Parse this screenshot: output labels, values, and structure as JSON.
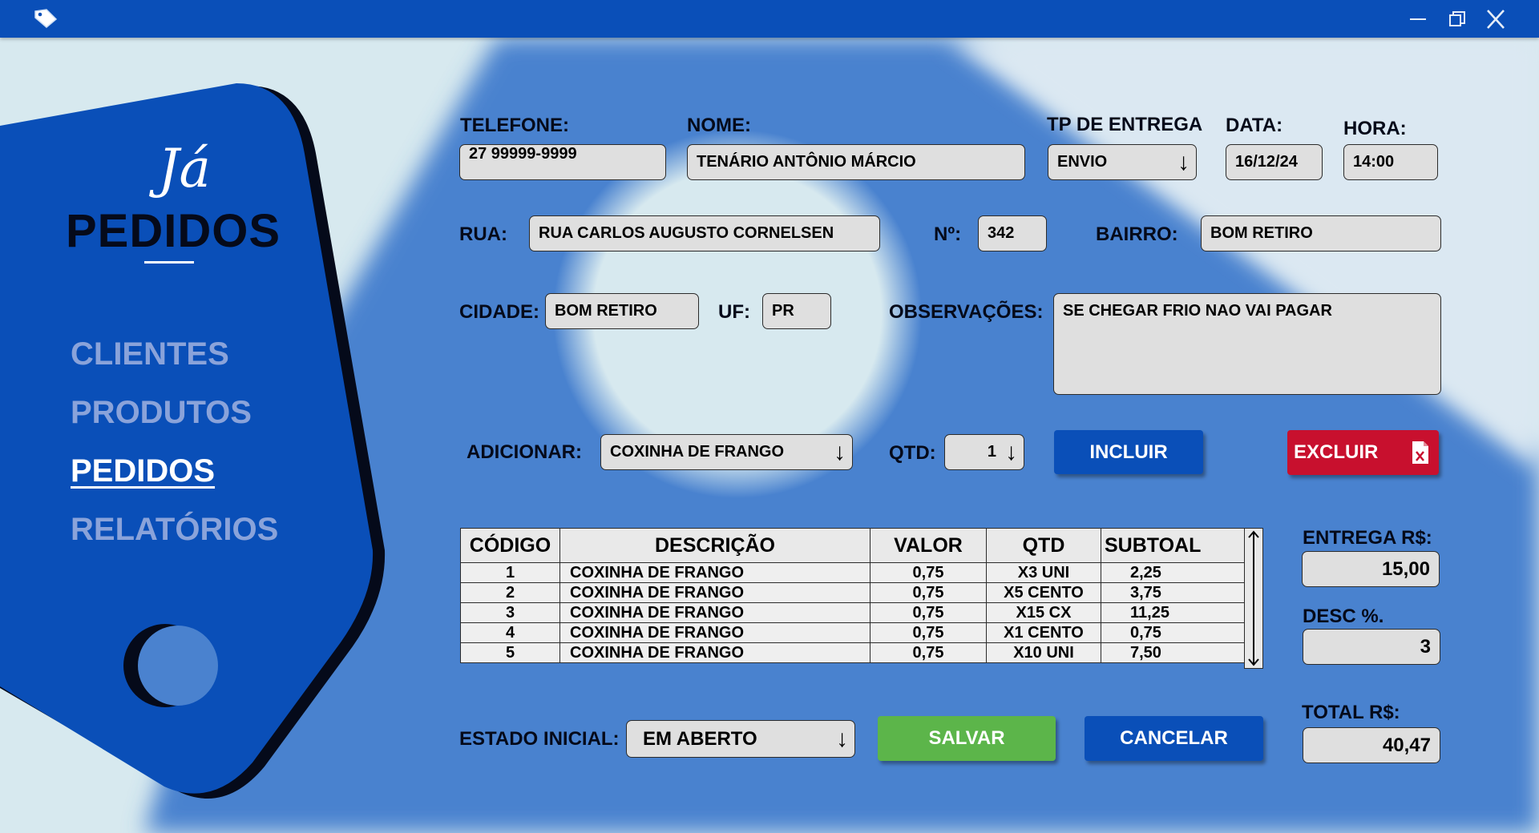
{
  "window": {
    "minimize_glyph": "—",
    "maximize_glyph": "❐",
    "close_glyph": "X",
    "icons": [
      "app-tag-icon",
      "minimize-icon",
      "restore-icon",
      "close-icon"
    ]
  },
  "logo": {
    "script": "Já",
    "main": "PEDIDOS"
  },
  "nav": [
    {
      "label": "CLIENTES",
      "active": false
    },
    {
      "label": "PRODUTOS",
      "active": false
    },
    {
      "label": "PEDIDOS",
      "active": true
    },
    {
      "label": "RELATÓRIOS",
      "active": false
    }
  ],
  "form": {
    "telefone_label": "TELEFONE:",
    "telefone": "27 99999-9999",
    "nome_label": "NOME:",
    "nome": "TENÁRIO ANTÔNIO MÁRCIO",
    "tp_entrega_label": "TP DE ENTREGA",
    "tp_entrega": "ENVIO",
    "data_label": "DATA:",
    "data": "16/12/24",
    "hora_label": "HORA:",
    "hora": "14:00",
    "rua_label": "RUA:",
    "rua": "RUA CARLOS AUGUSTO CORNELSEN",
    "numero_label": "Nº:",
    "numero": "342",
    "bairro_label": "BAIRRO:",
    "bairro": "BOM RETIRO",
    "cidade_label": "CIDADE:",
    "cidade": "BOM RETIRO",
    "uf_label": "UF:",
    "uf": "PR",
    "observacoes_label": "OBSERVAÇÕES:",
    "observacoes": "SE CHEGAR FRIO NAO VAI PAGAR",
    "adicionar_label": "ADICIONAR:",
    "adicionar": "COXINHA DE FRANGO",
    "qtd_label": "QTD:",
    "qtd": "1",
    "dropdown_arrow": "↓"
  },
  "buttons": {
    "incluir": "INCLUIR",
    "excluir": "EXCLUIR",
    "salvar": "SALVAR",
    "cancelar": "CANCELAR"
  },
  "table": {
    "headers": [
      "CÓDIGO",
      "DESCRIÇÃO",
      "VALOR",
      "QTD",
      "SUBTOAL"
    ],
    "rows": [
      [
        "1",
        "COXINHA DE FRANGO",
        "0,75",
        "X3 UNI",
        "2,25"
      ],
      [
        "2",
        "COXINHA DE FRANGO",
        "0,75",
        "X5 CENTO",
        "3,75"
      ],
      [
        "3",
        "COXINHA DE FRANGO",
        "0,75",
        "X15 CX",
        "11,25"
      ],
      [
        "4",
        "COXINHA DE FRANGO",
        "0,75",
        "X1 CENTO",
        "0,75"
      ],
      [
        "5",
        "COXINHA DE FRANGO",
        "0,75",
        "X10 UNI",
        "7,50"
      ]
    ]
  },
  "totals": {
    "entrega_label": "ENTREGA R$:",
    "entrega": "15,00",
    "desc_label": "DESC %.",
    "desc": "3",
    "total_label": "TOTAL R$:",
    "total": "40,47"
  },
  "estado": {
    "label": "ESTADO INICIAL:",
    "value": "EM ABERTO"
  },
  "colors": {
    "titlebar": "#0a4fb8",
    "panel": "#0a4fb8",
    "background": "#4a82cf",
    "incluir": "#0a4fb8",
    "excluir": "#c8102e",
    "salvar": "#5cb54a",
    "cancelar": "#0a4fb8"
  }
}
